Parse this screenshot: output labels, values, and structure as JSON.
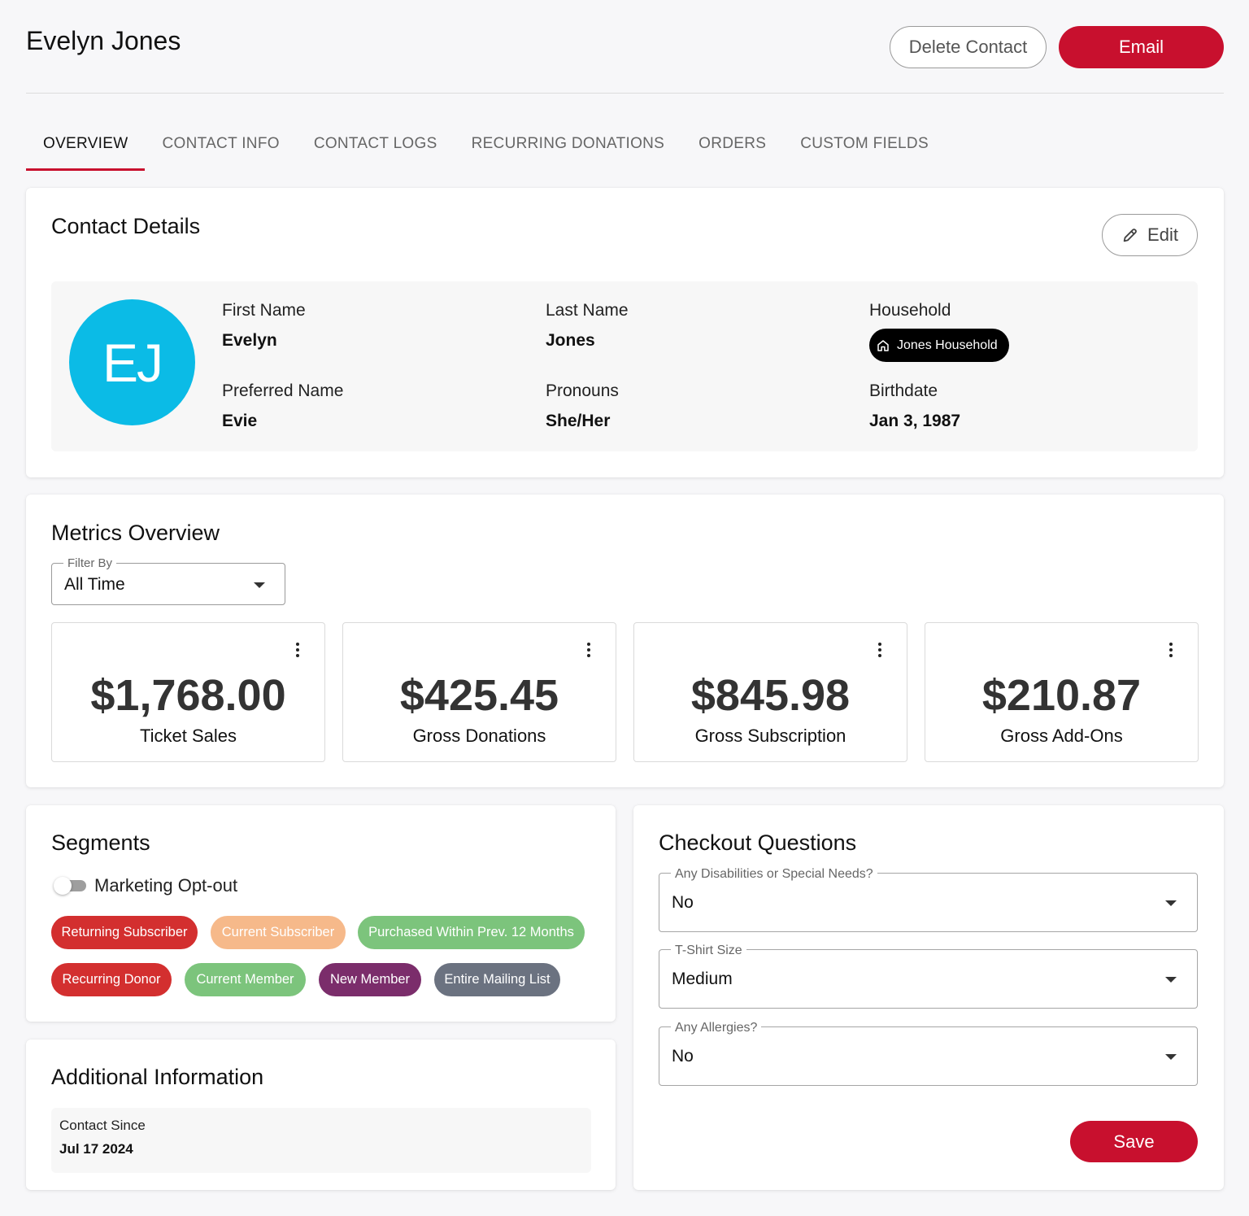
{
  "header": {
    "title": "Evelyn Jones",
    "delete_label": "Delete Contact",
    "email_label": "Email"
  },
  "tabs": [
    {
      "label": "OVERVIEW",
      "active": true
    },
    {
      "label": "CONTACT INFO",
      "active": false
    },
    {
      "label": "CONTACT LOGS",
      "active": false
    },
    {
      "label": "RECURRING DONATIONS",
      "active": false
    },
    {
      "label": "ORDERS",
      "active": false
    },
    {
      "label": "CUSTOM FIELDS",
      "active": false
    }
  ],
  "contact_details": {
    "title": "Contact Details",
    "edit_label": "Edit",
    "avatar_initials": "EJ",
    "avatar_color": "#0bbbe6",
    "fields": {
      "first_name": {
        "label": "First Name",
        "value": "Evelyn"
      },
      "last_name": {
        "label": "Last Name",
        "value": "Jones"
      },
      "household": {
        "label": "Household",
        "value": "Jones Household"
      },
      "preferred_name": {
        "label": "Preferred Name",
        "value": "Evie"
      },
      "pronouns": {
        "label": "Pronouns",
        "value": "She/Her"
      },
      "birthdate": {
        "label": "Birthdate",
        "value": "Jan 3, 1987"
      }
    }
  },
  "metrics": {
    "title": "Metrics Overview",
    "filter_label": "Filter By",
    "filter_value": "All Time",
    "items": [
      {
        "value": "$1,768.00",
        "label": "Ticket Sales"
      },
      {
        "value": "$425.45",
        "label": "Gross Donations"
      },
      {
        "value": "$845.98",
        "label": "Gross Subscription"
      },
      {
        "value": "$210.87",
        "label": "Gross Add-Ons"
      }
    ]
  },
  "segments": {
    "title": "Segments",
    "toggle_label": "Marketing Opt-out",
    "toggle_on": false,
    "chips": [
      {
        "label": "Returning Subscriber",
        "color": "#d32f2f"
      },
      {
        "label": "Current Subscriber",
        "color": "#f6b98a"
      },
      {
        "label": "Purchased Within Prev. 12 Months",
        "color": "#7cc47c"
      },
      {
        "label": "Recurring Donor",
        "color": "#d32f2f"
      },
      {
        "label": "Current Member",
        "color": "#7cc47c"
      },
      {
        "label": "New Member",
        "color": "#7b2d6b"
      },
      {
        "label": "Entire Mailing List",
        "color": "#6b7280"
      }
    ]
  },
  "additional_info": {
    "title": "Additional Information",
    "contact_since_label": "Contact Since",
    "contact_since_value": "Jul 17 2024"
  },
  "checkout": {
    "title": "Checkout Questions",
    "questions": [
      {
        "label": "Any Disabilities or Special Needs?",
        "value": "No"
      },
      {
        "label": "T-Shirt Size",
        "value": "Medium"
      },
      {
        "label": "Any Allergies?",
        "value": "No"
      }
    ],
    "save_label": "Save"
  },
  "colors": {
    "brand_red": "#c8102e"
  }
}
